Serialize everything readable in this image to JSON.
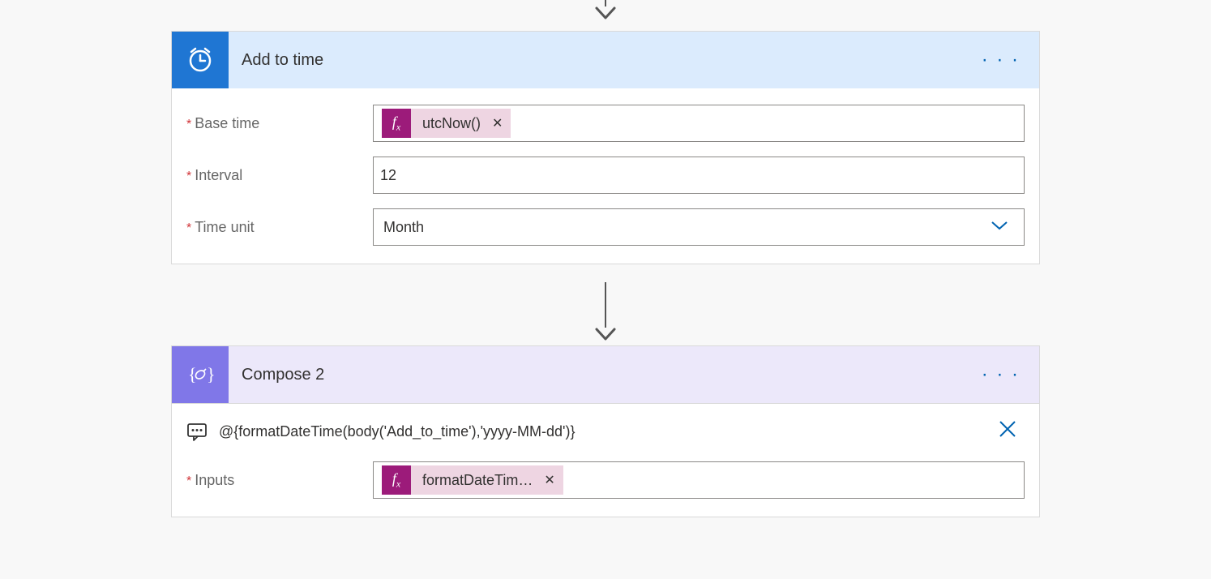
{
  "top_arrow": true,
  "cards": {
    "add_to_time": {
      "title": "Add to time",
      "fields": {
        "base_time": {
          "label": "Base time",
          "required": true,
          "token_label": "utcNow()"
        },
        "interval": {
          "label": "Interval",
          "required": true,
          "value": "12"
        },
        "time_unit": {
          "label": "Time unit",
          "required": true,
          "value": "Month"
        }
      }
    },
    "compose2": {
      "title": "Compose 2",
      "hint": "@{formatDateTime(body('Add_to_time'),'yyyy-MM-dd')}",
      "fields": {
        "inputs": {
          "label": "Inputs",
          "required": true,
          "token_label": "formatDateTim…"
        }
      }
    }
  },
  "menu_dots": "· · ·"
}
